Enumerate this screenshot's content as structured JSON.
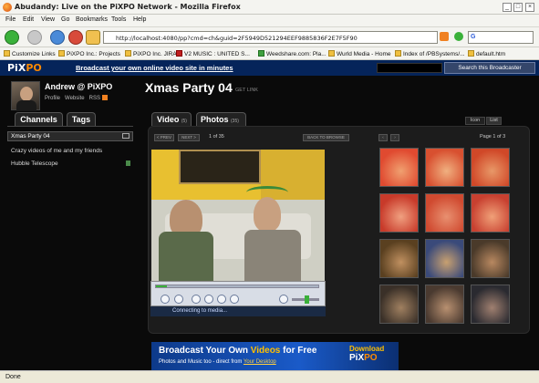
{
  "window": {
    "title": "Abudandy: Live on the PiXPO Network - Mozilla Firefox"
  },
  "menu": [
    "File",
    "Edit",
    "View",
    "Go",
    "Bookmarks",
    "Tools",
    "Help"
  ],
  "nav": {
    "url": "http://localhost:4080/pp?cmd=ch&guid=2F5949D521294EEF9885836F2E7F5F90",
    "search_prefix": "G"
  },
  "bookmarks": [
    "Customize Links",
    "PiXPO Inc.: Projects",
    "PiXPO Inc. JIRA",
    "V2 MUSIC : UNITED S...",
    "Weedshare.com: Pla...",
    "Wurld Media - Home",
    "Index of /PBSystems/...",
    "default.htm"
  ],
  "site": {
    "logo_pre": "PiX",
    "logo_post": "PO",
    "tagline": "Broadcast your own online video site in minutes",
    "search_button": "Search this Broadcaster"
  },
  "user": {
    "name": "Andrew @ PiXPO",
    "links": [
      "Profile",
      "Website",
      "RSS"
    ]
  },
  "sidebar": {
    "tabs": [
      "Channels",
      "Tags"
    ],
    "channels": [
      "Xmas Party 04",
      "Crazy videos of me and my friends",
      "Hubble Telescope"
    ]
  },
  "main": {
    "title": "Xmas Party 04",
    "get_link": "GET LINK",
    "tabs": [
      {
        "label": "Video",
        "count": "(5)"
      },
      {
        "label": "Photos",
        "count": "(35)"
      }
    ],
    "view_modes": [
      "Icon",
      "List"
    ],
    "prev": "< PREV",
    "next": "NEXT >",
    "counter": "1 of 35",
    "back": "BACK TO BROWSE",
    "page_label": "Page 1 of 3",
    "status": "Connecting to media..."
  },
  "banner": {
    "line1_pre": "Broadcast Your Own ",
    "line1_hl": "Videos",
    "line1_post": " for Free",
    "line2_pre": "Photos and Music too - direct from ",
    "line2_link": "Your Desktop",
    "download": "Download",
    "brand_pre": "PiX",
    "brand_post": "PO"
  },
  "statusbar": {
    "text": "Done"
  },
  "colors": {
    "site_header": "#05245a",
    "accent_orange": "#ff8a00",
    "panel": "#1c1c1c"
  }
}
